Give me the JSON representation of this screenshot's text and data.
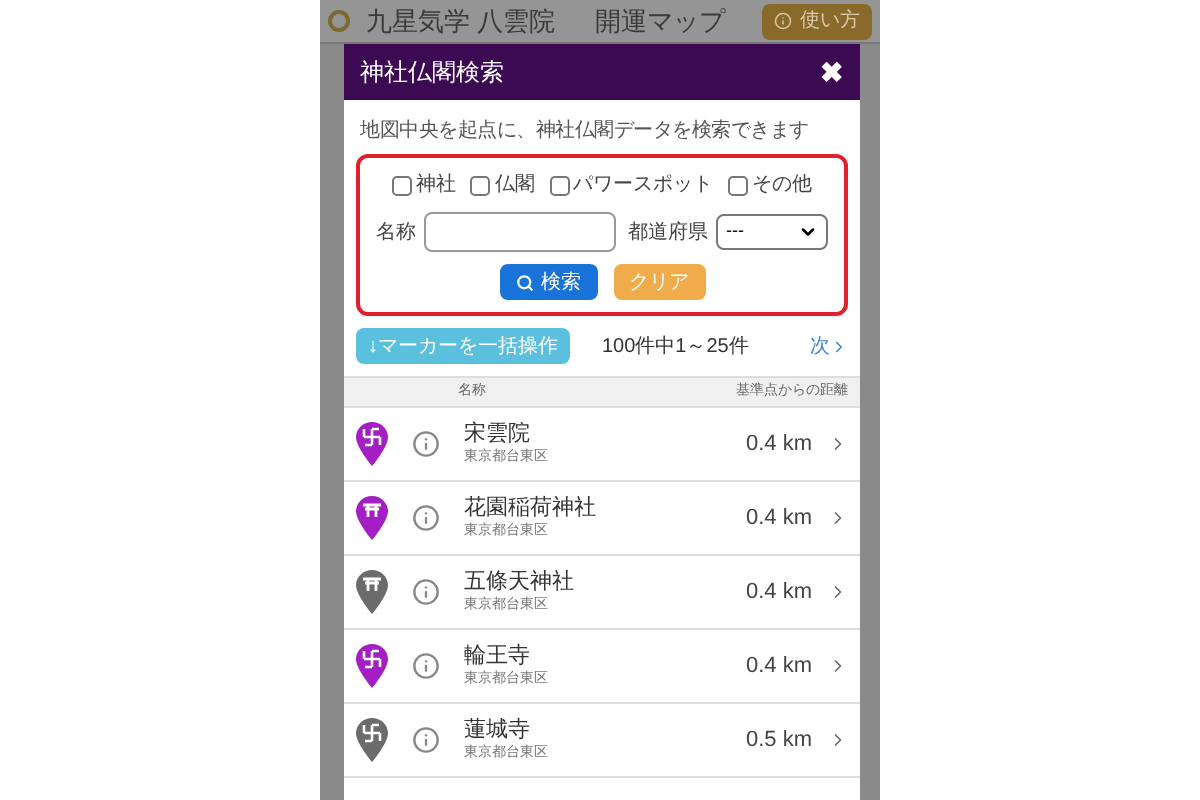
{
  "app_header": {
    "brand": "九星気学 八雲院",
    "title": "開運マップ",
    "help_button": "使い方"
  },
  "dialog": {
    "title": "神社仏閣検索",
    "close": "✖",
    "description": "地図中央を起点に、神社仏閣データを検索できます",
    "filters": [
      {
        "label": "神社",
        "checked": false
      },
      {
        "label": "仏閣",
        "checked": false
      },
      {
        "label": "パワースポット",
        "checked": false
      },
      {
        "label": "その他",
        "checked": false
      }
    ],
    "name_field": {
      "label": "名称"
    },
    "prefecture": {
      "label": "都道府県",
      "value": "---"
    },
    "search_button": "検索",
    "clear_button": "クリア",
    "bulk_button": "↓マーカーを一括操作",
    "result_count": "100件中1～25件",
    "next_link": "次",
    "table": {
      "columns": [
        "名称",
        "基準点からの距離"
      ],
      "rows": [
        {
          "kind": "temple",
          "color": "#a31fc4",
          "name": "宋雲院",
          "address": "東京都台東区",
          "distance": "0.4 km"
        },
        {
          "kind": "shrine",
          "color": "#a31fc4",
          "name": "花園稲荷神社",
          "address": "東京都台東区",
          "distance": "0.4 km"
        },
        {
          "kind": "shrine",
          "color": "#6b6b6b",
          "name": "五條天神社",
          "address": "東京都台東区",
          "distance": "0.4 km"
        },
        {
          "kind": "temple",
          "color": "#a31fc4",
          "name": "輪王寺",
          "address": "東京都台東区",
          "distance": "0.4 km"
        },
        {
          "kind": "temple",
          "color": "#6b6b6b",
          "name": "蓮城寺",
          "address": "東京都台東区",
          "distance": "0.5 km"
        }
      ]
    }
  }
}
